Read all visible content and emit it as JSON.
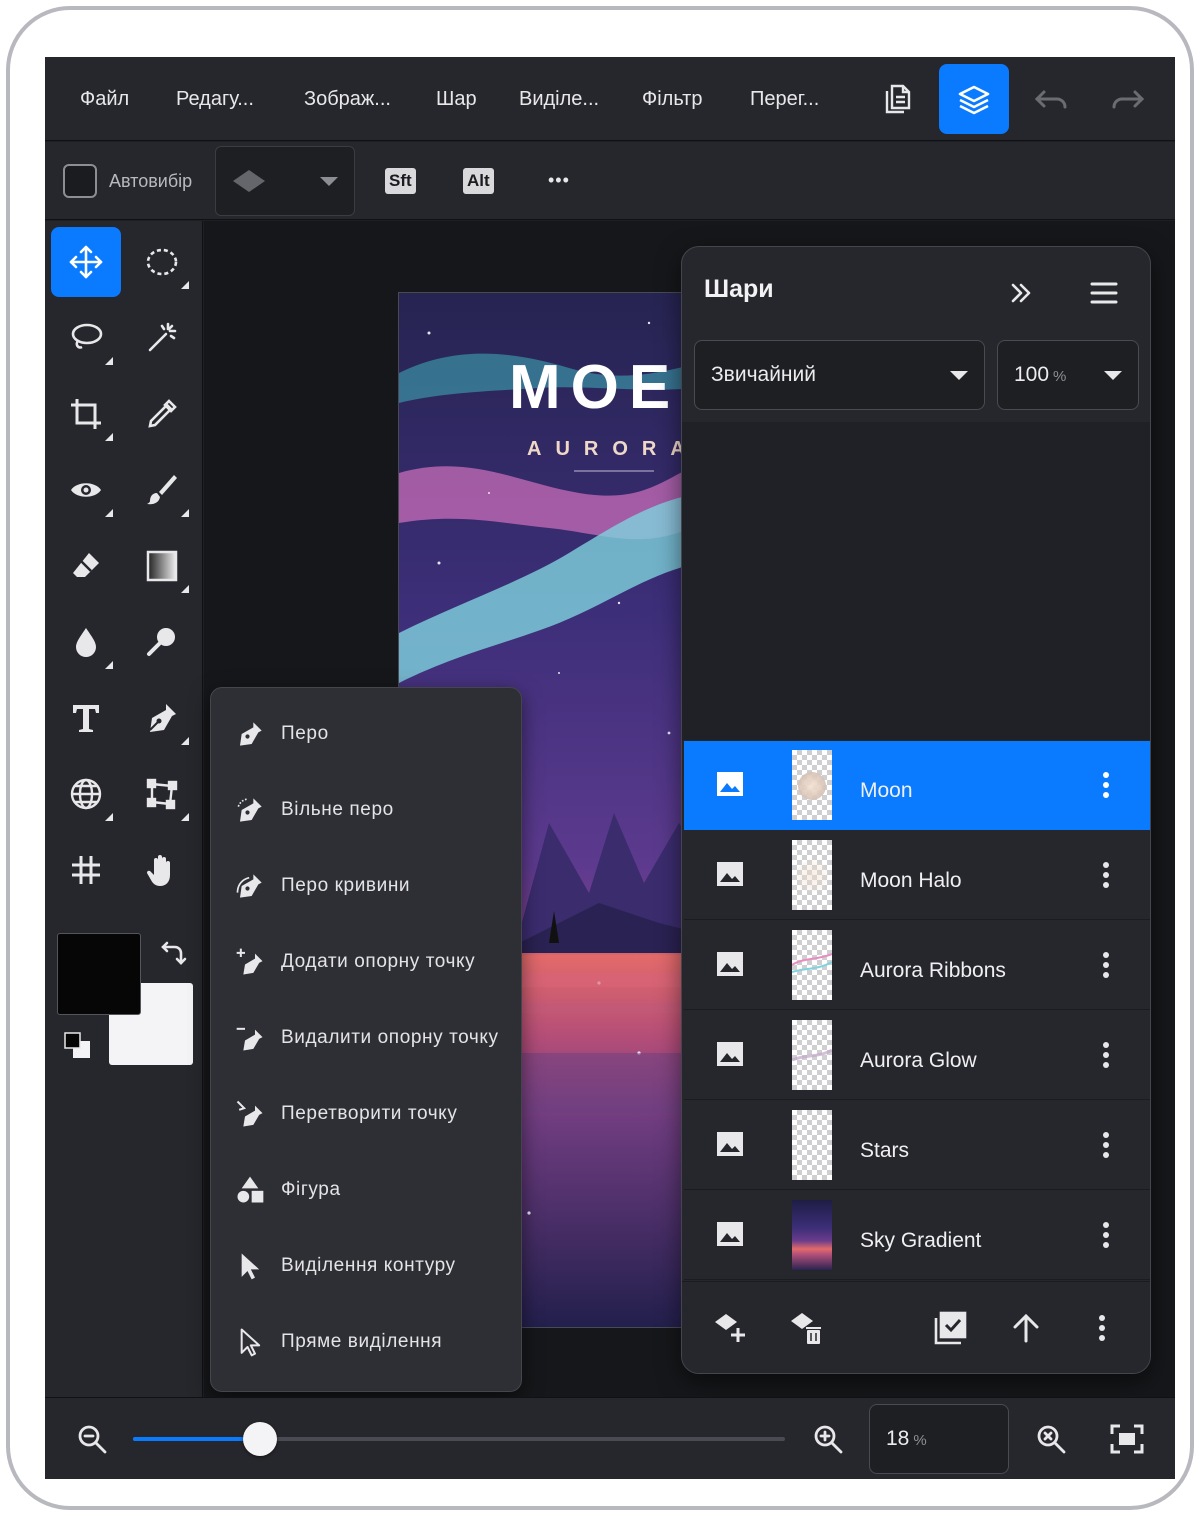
{
  "menu": {
    "items": [
      "Файл",
      "Редагу...",
      "Зображ...",
      "Шар",
      "Виділе...",
      "Фільтр",
      "Перег..."
    ]
  },
  "options": {
    "autoselect_label": "Автовибір",
    "shift_label": "Sft",
    "alt_label": "Alt",
    "more_label": "•••"
  },
  "toolbar": {
    "tools": [
      "move-tool",
      "marquee-tool",
      "lasso-tool",
      "magic-wand-tool",
      "crop-tool",
      "eyedropper-tool",
      "red-eye-tool",
      "brush-tool",
      "eraser-tool",
      "gradient-tool",
      "blur-tool",
      "dodge-tool",
      "type-tool",
      "pen-tool",
      "globe-tool",
      "transform-tool",
      "grid-tool",
      "hand-tool"
    ],
    "foreground_color": "#060607",
    "background_color": "#f4f4f6"
  },
  "artboard": {
    "title": "МОЕ",
    "subtitle": "AURORA"
  },
  "pen_menu": {
    "items": [
      {
        "label": "Перо",
        "icon": "pen-icon"
      },
      {
        "label": "Вільне перо",
        "icon": "freeform-pen-icon"
      },
      {
        "label": "Перо кривини",
        "icon": "curvature-pen-icon"
      },
      {
        "label": "Додати опорну точку",
        "icon": "add-anchor-icon"
      },
      {
        "label": "Видалити опорну точку",
        "icon": "delete-anchor-icon"
      },
      {
        "label": "Перетворити точку",
        "icon": "convert-point-icon"
      },
      {
        "label": "Фігура",
        "icon": "shape-icon"
      },
      {
        "label": "Виділення контуру",
        "icon": "path-select-icon"
      },
      {
        "label": "Пряме виділення",
        "icon": "direct-select-icon"
      }
    ]
  },
  "layers": {
    "title": "Шари",
    "blend_mode": "Звичайний",
    "opacity_value": "100",
    "opacity_unit": "%",
    "items": [
      {
        "name": "Moon",
        "selected": true
      },
      {
        "name": "Moon Halo",
        "selected": false
      },
      {
        "name": "Aurora Ribbons",
        "selected": false
      },
      {
        "name": "Aurora Glow",
        "selected": false
      },
      {
        "name": "Stars",
        "selected": false
      },
      {
        "name": "Sky Gradient",
        "selected": false
      }
    ]
  },
  "zoom": {
    "value": "18",
    "unit": "%",
    "slider_fraction": 0.195
  },
  "colors": {
    "accent": "#0a7aff",
    "panel": "#26272c",
    "canvas": "#16171a"
  }
}
